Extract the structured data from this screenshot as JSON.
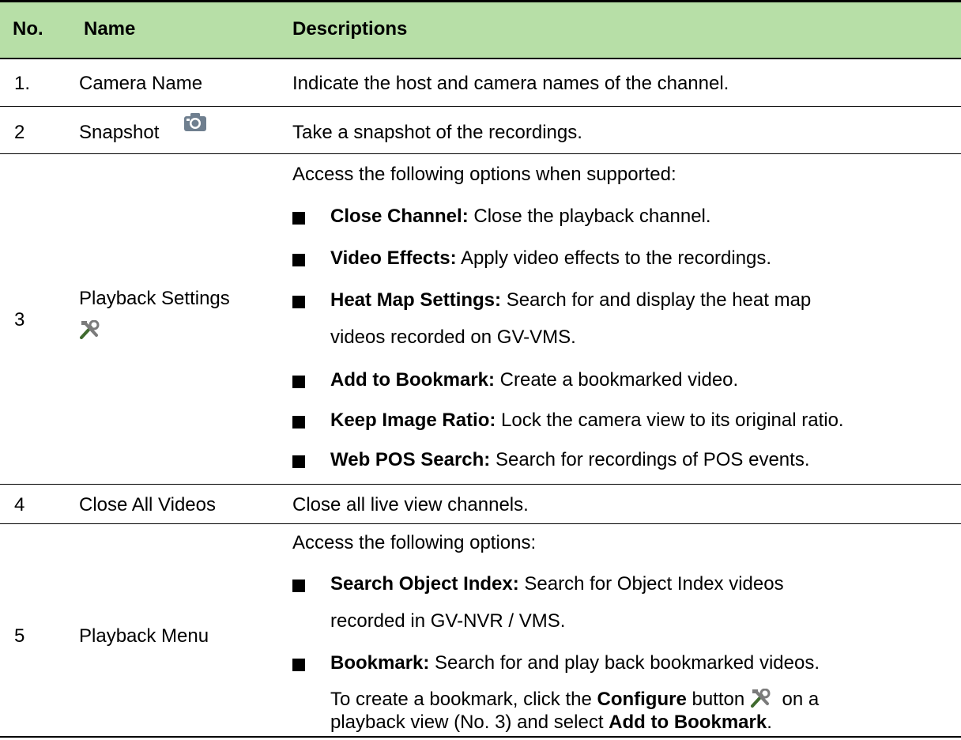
{
  "header": {
    "no": "No.",
    "name": "Name",
    "desc": "Descriptions"
  },
  "rows": [
    {
      "no": "1.",
      "name": "Camera Name",
      "desc": "Indicate the host and camera names of the channel."
    },
    {
      "no": "2",
      "name": "Snapshot",
      "desc": "Take a snapshot of the recordings."
    },
    {
      "no": "3",
      "name": "Playback Settings",
      "intro": "Access the following options when supported:",
      "items": [
        {
          "term": "Close Channel:",
          "text": " Close the playback channel."
        },
        {
          "term": "Video Effects:",
          "text": " Apply video effects to the recordings."
        },
        {
          "term": "Heat Map Settings:",
          "text": " Search for and display the heat map",
          "cont": "videos recorded on GV-VMS."
        },
        {
          "term": "Add to Bookmark:",
          "text": " Create a bookmarked video."
        },
        {
          "term": "Keep Image Ratio:",
          "text": " Lock the camera view to its original ratio."
        },
        {
          "term": "Web POS Search:",
          "text": " Search for recordings of POS events."
        }
      ]
    },
    {
      "no": "4",
      "name": "Close All Videos",
      "desc": "Close all live view channels."
    },
    {
      "no": "5",
      "name": "Playback Menu",
      "intro": "Access the following options:",
      "items": [
        {
          "term": "Search Object Index:",
          "text": " Search for Object Index videos",
          "cont": "recorded in GV-NVR / VMS."
        },
        {
          "term": "Bookmark:",
          "text": " Search for and play back bookmarked videos."
        }
      ],
      "note_pre": "To create a bookmark, click the ",
      "note_bold": "Configure",
      "note_mid": " button ",
      "note_post": " on a",
      "note2_pre": "playback view (No. 3) and select ",
      "note2_bold": "Add to Bookmark",
      "note2_post": "."
    }
  ],
  "icons": {
    "snapshot": "camera-icon",
    "settings": "tools-icon"
  }
}
